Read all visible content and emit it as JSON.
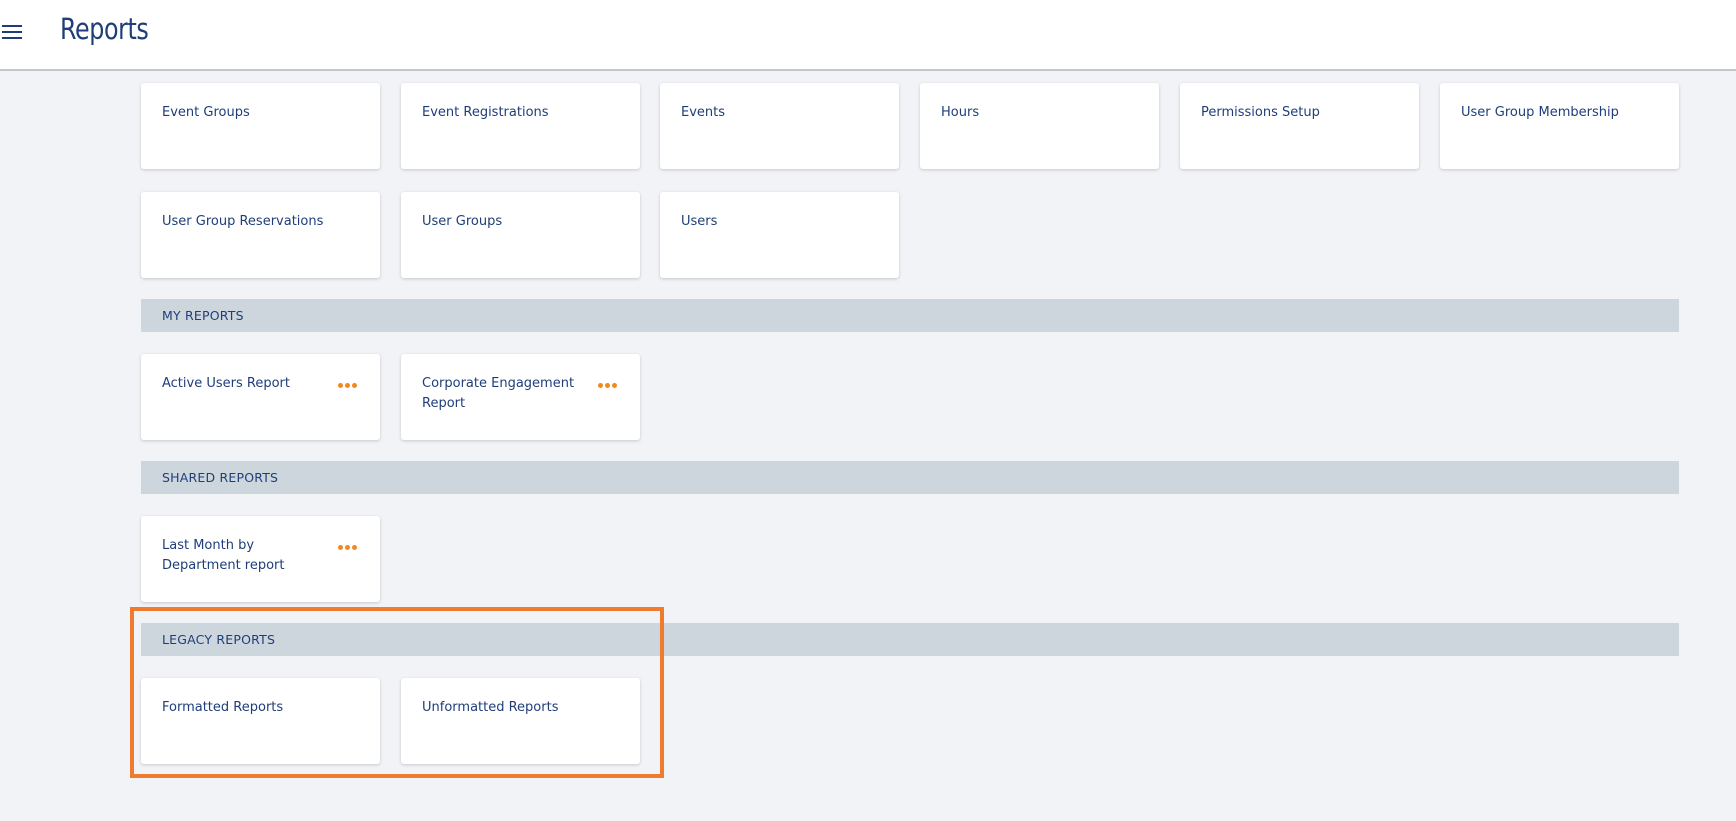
{
  "header": {
    "menu_icon": "hamburger-menu-icon",
    "title": "Reports"
  },
  "standard_reports": [
    {
      "label": "Event Groups"
    },
    {
      "label": "Event Registrations"
    },
    {
      "label": "Events"
    },
    {
      "label": "Hours"
    },
    {
      "label": "Permissions Setup"
    },
    {
      "label": "User Group Membership"
    },
    {
      "label": "User Group Reservations"
    },
    {
      "label": "User Groups"
    },
    {
      "label": "Users"
    }
  ],
  "my_reports": {
    "title": "MY REPORTS",
    "items": [
      {
        "label": "Active Users Report",
        "menu_icon": "more-options-icon"
      },
      {
        "label": "Corporate Engagement Report",
        "menu_icon": "more-options-icon"
      }
    ]
  },
  "shared_reports": {
    "title": "SHARED REPORTS",
    "items": [
      {
        "label": "Last Month by Department report",
        "menu_icon": "more-options-icon"
      }
    ]
  },
  "legacy_reports": {
    "title": "LEGACY REPORTS",
    "items": [
      {
        "label": "Formatted Reports"
      },
      {
        "label": "Unformatted Reports"
      }
    ]
  },
  "colors": {
    "brand": "#1f3e79",
    "accent": "#f08a1e",
    "highlight": "#ef7b2e",
    "section_bg": "#ced6dd",
    "page_bg": "#f1f3f6"
  }
}
